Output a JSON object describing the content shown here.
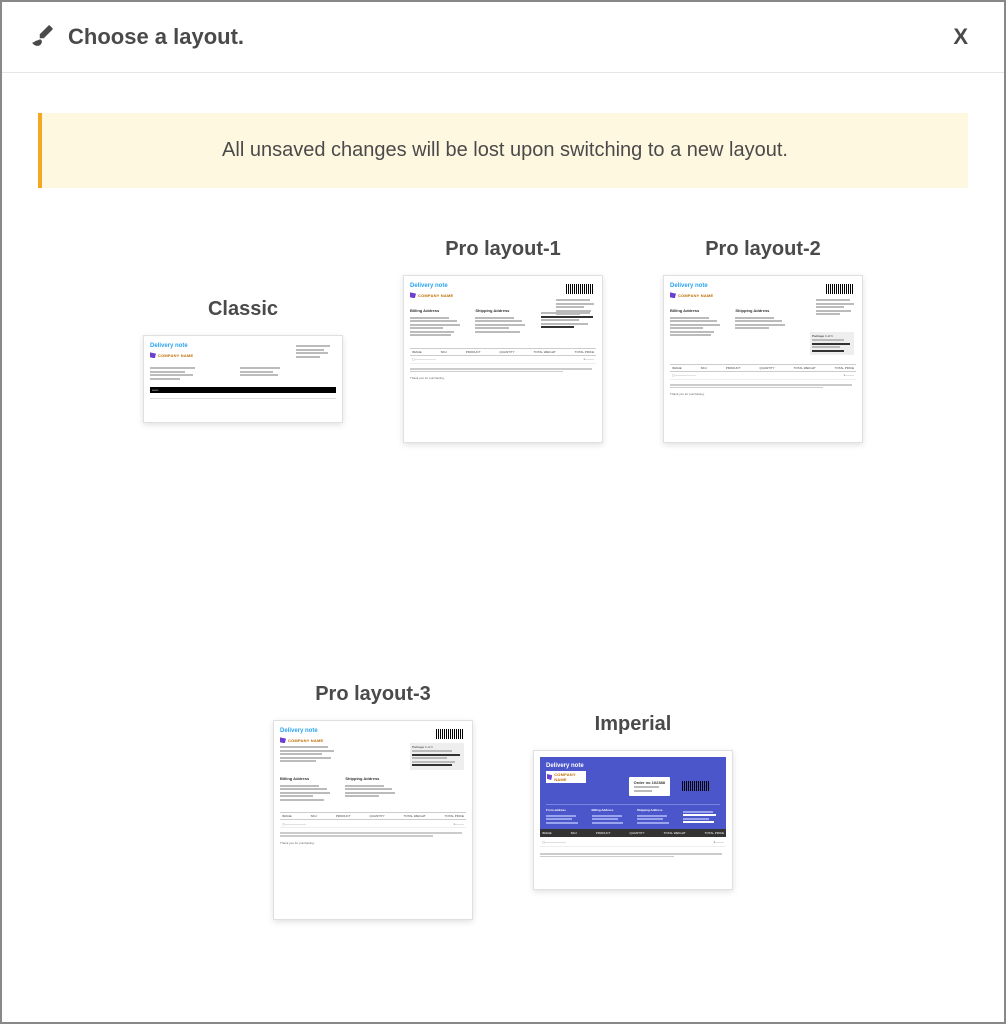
{
  "header": {
    "title": "Choose a layout.",
    "close_label": "X"
  },
  "warning": {
    "text": "All unsaved changes will be lost upon switching to a new layout."
  },
  "layouts": {
    "classic": {
      "title": "Classic"
    },
    "pro1": {
      "title": "Pro layout-1"
    },
    "pro2": {
      "title": "Pro layout-2"
    },
    "pro3": {
      "title": "Pro layout-3"
    },
    "imperial": {
      "title": "Imperial"
    }
  },
  "preview_strings": {
    "delivery_note": "Delivery note",
    "company_name": "COMPANY NAME",
    "billing": "Billing Address",
    "shipping": "Shipping Address",
    "table": {
      "image": "IMAGE",
      "sku": "SKU",
      "product": "PRODUCT",
      "quantity": "QUANTITY",
      "total_weight": "TOTAL WEIGHT",
      "total_price": "TOTAL PRICE"
    },
    "order_no": "Order no 102388",
    "thankyou": "Thank you for purchasing."
  }
}
